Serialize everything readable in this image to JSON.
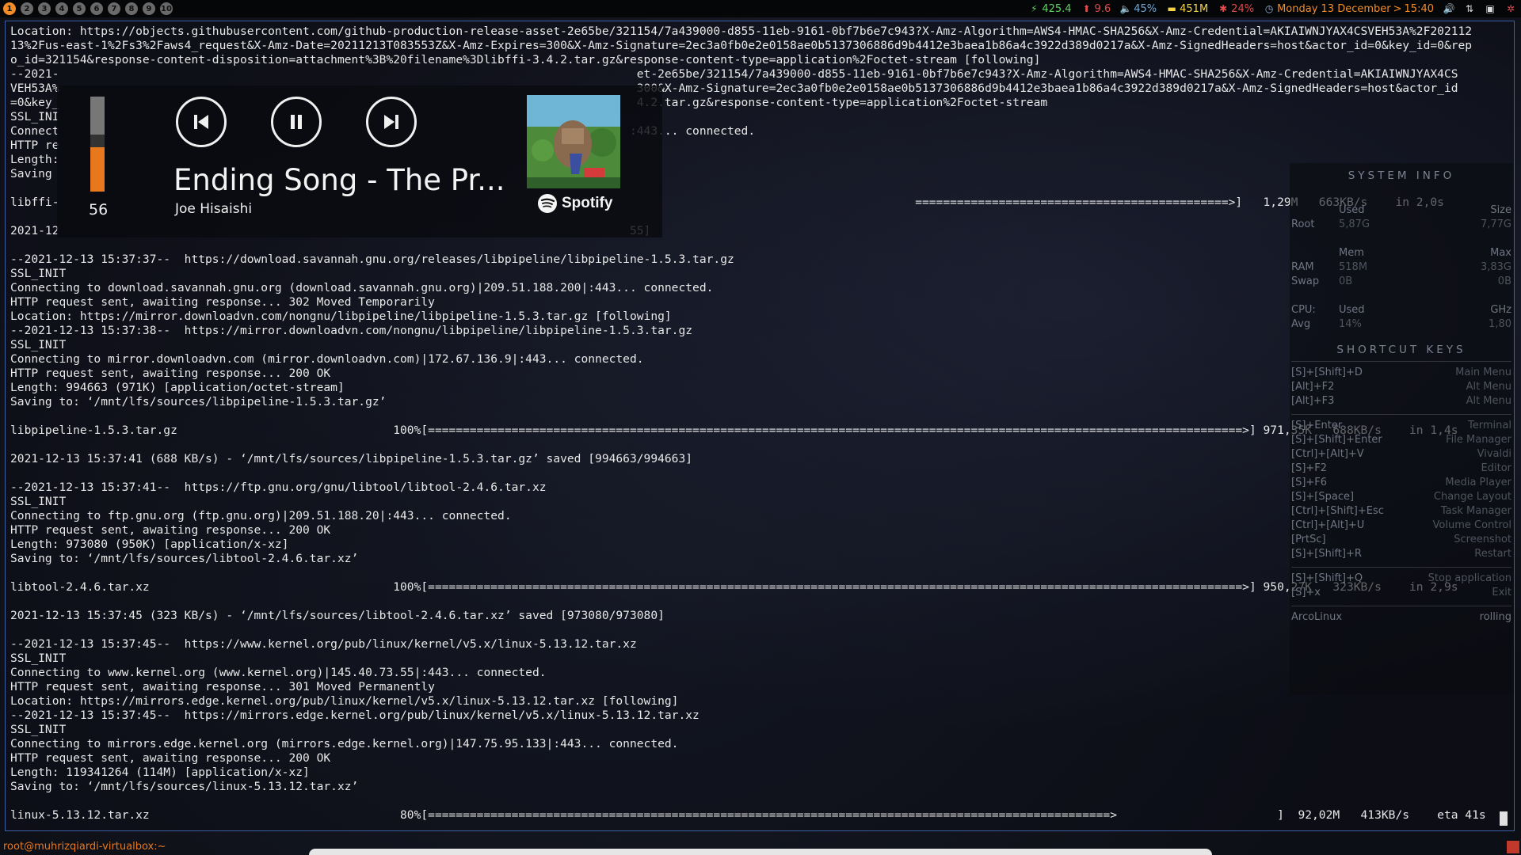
{
  "topbar": {
    "workspaces": [
      "1",
      "2",
      "3",
      "4",
      "5",
      "6",
      "7",
      "8",
      "9",
      "10"
    ],
    "active_workspace": "1",
    "stats": {
      "net_down": "425.4",
      "net_up": "9.6",
      "volume": "45%",
      "memory": "451M",
      "cpu": "24%",
      "date": "Monday 13 December",
      "time": "15:40"
    },
    "colors": {
      "net_down": "#5fd35f",
      "net_up": "#e04b4b",
      "volume": "#6fa8dc",
      "memory": "#f5d547",
      "cpu": "#e04b4b",
      "clock": "#f28c28"
    }
  },
  "terminal": {
    "lines": [
      "Location: https://objects.githubusercontent.com/github-production-release-asset-2e65be/321154/7a439000-d855-11eb-9161-0bf7b6e7c943?X-Amz-Algorithm=AWS4-HMAC-SHA256&X-Amz-Credential=AKIAIWNJYAX4CSVEH53A%2F202112",
      "13%2Fus-east-1%2Fs3%2Faws4_request&X-Amz-Date=20211213T083553Z&X-Amz-Expires=300&X-Amz-Signature=2ec3a0fb0e2e0158ae0b5137306886d9b4412e3baea1b86a4c3922d389d0217a&X-Amz-SignedHeaders=host&actor_id=0&key_id=0&rep",
      "o_id=321154&response-content-disposition=attachment%3B%20filename%3Dlibffi-3.4.2.tar.gz&response-content-type=application%2Foctet-stream [following]",
      "--2021-                                                                                   et-2e65be/321154/7a439000-d855-11eb-9161-0bf7b6e7c943?X-Amz-Algorithm=AWS4-HMAC-SHA256&X-Amz-Credential=AKIAIWNJYAX4CS",
      "VEH53A%                                                                                   300&X-Amz-Signature=2ec3a0fb0e2e0158ae0b5137306886d9b4412e3baea1b86a4c3922d389d0217a&X-Amz-SignedHeaders=host&actor_id",
      "=0&key_                                                                                   4.2.tar.gz&response-content-type=application%2Foctet-stream",
      "SSL_INI",
      "Connect                                                                                  :443... connected.",
      "HTTP re",
      "Length:",
      "Saving ",
      "",
      "libffi-                                                                                                                           =============================================>]   1,29M   663KB/s    in 2,0s",
      "",
      "2021-12                                                                                  55]",
      "",
      "--2021-12-13 15:37:37--  https://download.savannah.gnu.org/releases/libpipeline/libpipeline-1.5.3.tar.gz",
      "SSL_INIT",
      "Connecting to download.savannah.gnu.org (download.savannah.gnu.org)|209.51.188.200|:443... connected.",
      "HTTP request sent, awaiting response... 302 Moved Temporarily",
      "Location: https://mirror.downloadvn.com/nongnu/libpipeline/libpipeline-1.5.3.tar.gz [following]",
      "--2021-12-13 15:37:38--  https://mirror.downloadvn.com/nongnu/libpipeline/libpipeline-1.5.3.tar.gz",
      "SSL_INIT",
      "Connecting to mirror.downloadvn.com (mirror.downloadvn.com)|172.67.136.9|:443... connected.",
      "HTTP request sent, awaiting response... 200 OK",
      "Length: 994663 (971K) [application/octet-stream]",
      "Saving to: ‘/mnt/lfs/sources/libpipeline-1.5.3.tar.gz’",
      "",
      "libpipeline-1.5.3.tar.gz                               100%[=====================================================================================================================>] 971,35K   688KB/s    in 1,4s",
      "",
      "2021-12-13 15:37:41 (688 KB/s) - ‘/mnt/lfs/sources/libpipeline-1.5.3.tar.gz’ saved [994663/994663]",
      "",
      "--2021-12-13 15:37:41--  https://ftp.gnu.org/gnu/libtool/libtool-2.4.6.tar.xz",
      "SSL_INIT",
      "Connecting to ftp.gnu.org (ftp.gnu.org)|209.51.188.20|:443... connected.",
      "HTTP request sent, awaiting response... 200 OK",
      "Length: 973080 (950K) [application/x-xz]",
      "Saving to: ‘/mnt/lfs/sources/libtool-2.4.6.tar.xz’",
      "",
      "libtool-2.4.6.tar.xz                                   100%[=====================================================================================================================>] 950,27K   323KB/s    in 2,9s",
      "",
      "2021-12-13 15:37:45 (323 KB/s) - ‘/mnt/lfs/sources/libtool-2.4.6.tar.xz’ saved [973080/973080]",
      "",
      "--2021-12-13 15:37:45--  https://www.kernel.org/pub/linux/kernel/v5.x/linux-5.13.12.tar.xz",
      "SSL_INIT",
      "Connecting to www.kernel.org (www.kernel.org)|145.40.73.55|:443... connected.",
      "HTTP request sent, awaiting response... 301 Moved Permanently",
      "Location: https://mirrors.edge.kernel.org/pub/linux/kernel/v5.x/linux-5.13.12.tar.xz [following]",
      "--2021-12-13 15:37:45--  https://mirrors.edge.kernel.org/pub/linux/kernel/v5.x/linux-5.13.12.tar.xz",
      "SSL_INIT",
      "Connecting to mirrors.edge.kernel.org (mirrors.edge.kernel.org)|147.75.95.133|:443... connected.",
      "HTTP request sent, awaiting response... 200 OK",
      "Length: 119341264 (114M) [application/x-xz]",
      "Saving to: ‘/mnt/lfs/sources/linux-5.13.12.tar.xz’",
      "",
      "linux-5.13.12.tar.xz                                    80%[==================================================================================================>                       ]  92,02M   413KB/s    eta 41s"
    ]
  },
  "media": {
    "volume_value": "56",
    "volume_level": 0.56,
    "title": "Ending Song - The Pr...",
    "artist": "Joe Hisaishi",
    "source": "Spotify",
    "buttons": {
      "prev": "previous-track",
      "play_pause": "pause",
      "next": "next-track"
    }
  },
  "sysinfo": {
    "system_title": "SYSTEM INFO",
    "disk_header": {
      "used": "Used",
      "size": "Size"
    },
    "root": {
      "label": "Root",
      "used": "5,87G",
      "size": "7,77G"
    },
    "mem_header": {
      "mem": "Mem",
      "max": "Max"
    },
    "ram": {
      "label": "RAM",
      "used": "518M",
      "max": "3,83G"
    },
    "swap": {
      "label": "Swap",
      "used": "0B",
      "max": "0B"
    },
    "cpu_header": {
      "label": "CPU:",
      "used": "Used",
      "ghz": "GHz"
    },
    "avg": {
      "label": "Avg",
      "used": "14%",
      "ghz": "1,80"
    },
    "shortcut_title": "SHORTCUT KEYS",
    "shortcuts_1": [
      {
        "key": "[S]+[Shift]+D",
        "action": "Main Menu"
      },
      {
        "key": "[Alt]+F2",
        "action": "Alt Menu"
      },
      {
        "key": "[Alt]+F3",
        "action": "Alt Menu"
      }
    ],
    "shortcuts_2": [
      {
        "key": "[S]+Enter",
        "action": "Terminal"
      },
      {
        "key": "[S]+[Shift]+Enter",
        "action": "File Manager"
      },
      {
        "key": "[Ctrl]+[Alt]+V",
        "action": "Vivaldi"
      },
      {
        "key": "[S]+F2",
        "action": "Editor"
      },
      {
        "key": "[S]+F6",
        "action": "Media Player"
      },
      {
        "key": "[S]+[Space]",
        "action": "Change Layout"
      },
      {
        "key": "[Ctrl]+[Shift]+Esc",
        "action": "Task Manager"
      },
      {
        "key": "[Ctrl]+[Alt]+U",
        "action": "Volume Control"
      },
      {
        "key": "[PrtSc]",
        "action": "Screenshot"
      },
      {
        "key": "[S]+[Shift]+R",
        "action": "Restart"
      }
    ],
    "shortcuts_3": [
      {
        "key": "[S]+[Shift]+Q",
        "action": "Stop application"
      },
      {
        "key": "[S]+x",
        "action": "Exit"
      }
    ],
    "distro": "ArcoLinux",
    "release": "rolling"
  },
  "bottom": {
    "prompt": "root@muhrizqiardi-virtualbox:~"
  }
}
